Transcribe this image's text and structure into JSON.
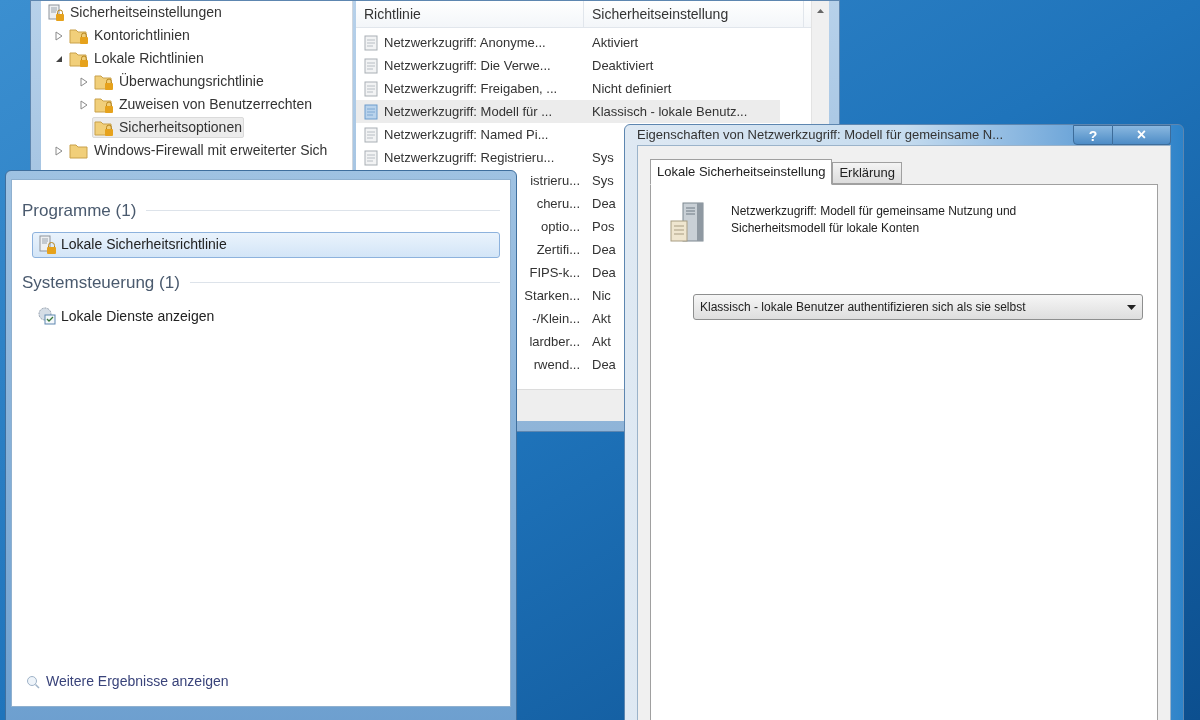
{
  "mmc": {
    "tree": [
      {
        "label": "Sicherheitseinstellungen",
        "kind": "root",
        "selected": false,
        "children": [
          {
            "label": "Kontorichtlinien",
            "kind": "secure-folder",
            "expanded": false,
            "selected": false
          },
          {
            "label": "Lokale Richtlinien",
            "kind": "secure-folder",
            "expanded": true,
            "selected": false,
            "children": [
              {
                "label": "Überwachungsrichtlinie",
                "kind": "secure-folder",
                "expanded": false,
                "selected": false
              },
              {
                "label": "Zuweisen von Benutzerrechten",
                "kind": "secure-folder",
                "expanded": false,
                "selected": false
              },
              {
                "label": "Sicherheitsoptionen",
                "kind": "secure-folder",
                "selected": true
              }
            ]
          },
          {
            "label": "Windows-Firewall mit erweiterter Sich",
            "kind": "folder",
            "expanded": false,
            "selected": false
          }
        ]
      }
    ],
    "list": {
      "columns": [
        "Richtlinie",
        "Sicherheitseinstellung"
      ],
      "rows": [
        {
          "kind": "full",
          "policy": "Netzwerkzugriff: Anonyme...",
          "setting": "Aktiviert",
          "selected": false
        },
        {
          "kind": "full",
          "policy": "Netzwerkzugriff: Die Verwe...",
          "setting": "Deaktiviert",
          "selected": false
        },
        {
          "kind": "full",
          "policy": "Netzwerkzugriff: Freigaben, ...",
          "setting": "Nicht definiert",
          "selected": false
        },
        {
          "kind": "full",
          "policy": "Netzwerkzugriff: Modell für ...",
          "setting": "Klassisch - lokale Benutz...",
          "selected": true
        },
        {
          "kind": "full",
          "policy": "Netzwerkzugriff: Named Pi...",
          "selected": false
        },
        {
          "kind": "full",
          "policy": "Netzwerkzugriff: Registrieru...",
          "setting": "Sys",
          "selected": false
        },
        {
          "kind": "partial",
          "policy": "istrieru...",
          "setting": "Sys",
          "selected": false
        },
        {
          "kind": "partial",
          "policy": "cheru...",
          "setting": "Dea",
          "selected": false
        },
        {
          "kind": "partial",
          "policy": "optio...",
          "setting": "Pos",
          "selected": false
        },
        {
          "kind": "partial",
          "policy": "Zertifi...",
          "setting": "Dea",
          "selected": false
        },
        {
          "kind": "partial",
          "policy": "FIPS-k...",
          "setting": "Dea",
          "selected": false
        },
        {
          "kind": "partial",
          "policy": "Starken...",
          "setting": "Nic",
          "selected": false
        },
        {
          "kind": "partial",
          "policy": "-/Klein...",
          "setting": "Akt",
          "selected": false
        },
        {
          "kind": "partial",
          "policy": "lardber...",
          "setting": "Akt",
          "selected": false
        },
        {
          "kind": "partial",
          "policy": "rwend...",
          "setting": "Dea",
          "selected": false
        }
      ]
    }
  },
  "search_results": {
    "groups": [
      {
        "heading": "Programme (1)",
        "items": [
          {
            "label": "Lokale Sicherheitsrichtlinie",
            "kind": "policy",
            "selected": true
          }
        ]
      },
      {
        "heading": "Systemsteuerung (1)",
        "items": [
          {
            "label": "Lokale Dienste anzeigen",
            "kind": "services",
            "selected": false
          }
        ]
      }
    ],
    "more_results": "Weitere Ergebnisse anzeigen"
  },
  "dialog": {
    "title": "Eigenschaften von Netzwerkzugriff: Modell für gemeinsame N...",
    "help_button": "?",
    "close_button": "×",
    "tabs": [
      {
        "label": "Lokale Sicherheitseinstellung",
        "selected": true
      },
      {
        "label": "Erklärung",
        "selected": false
      }
    ],
    "description": "Netzwerkzugriff: Modell für gemeinsame Nutzung und Sicherheitsmodell für lokale Konten",
    "dropdown": {
      "value": "Klassisch - lokale Benutzer authentifizieren sich als sie selbst"
    }
  }
}
